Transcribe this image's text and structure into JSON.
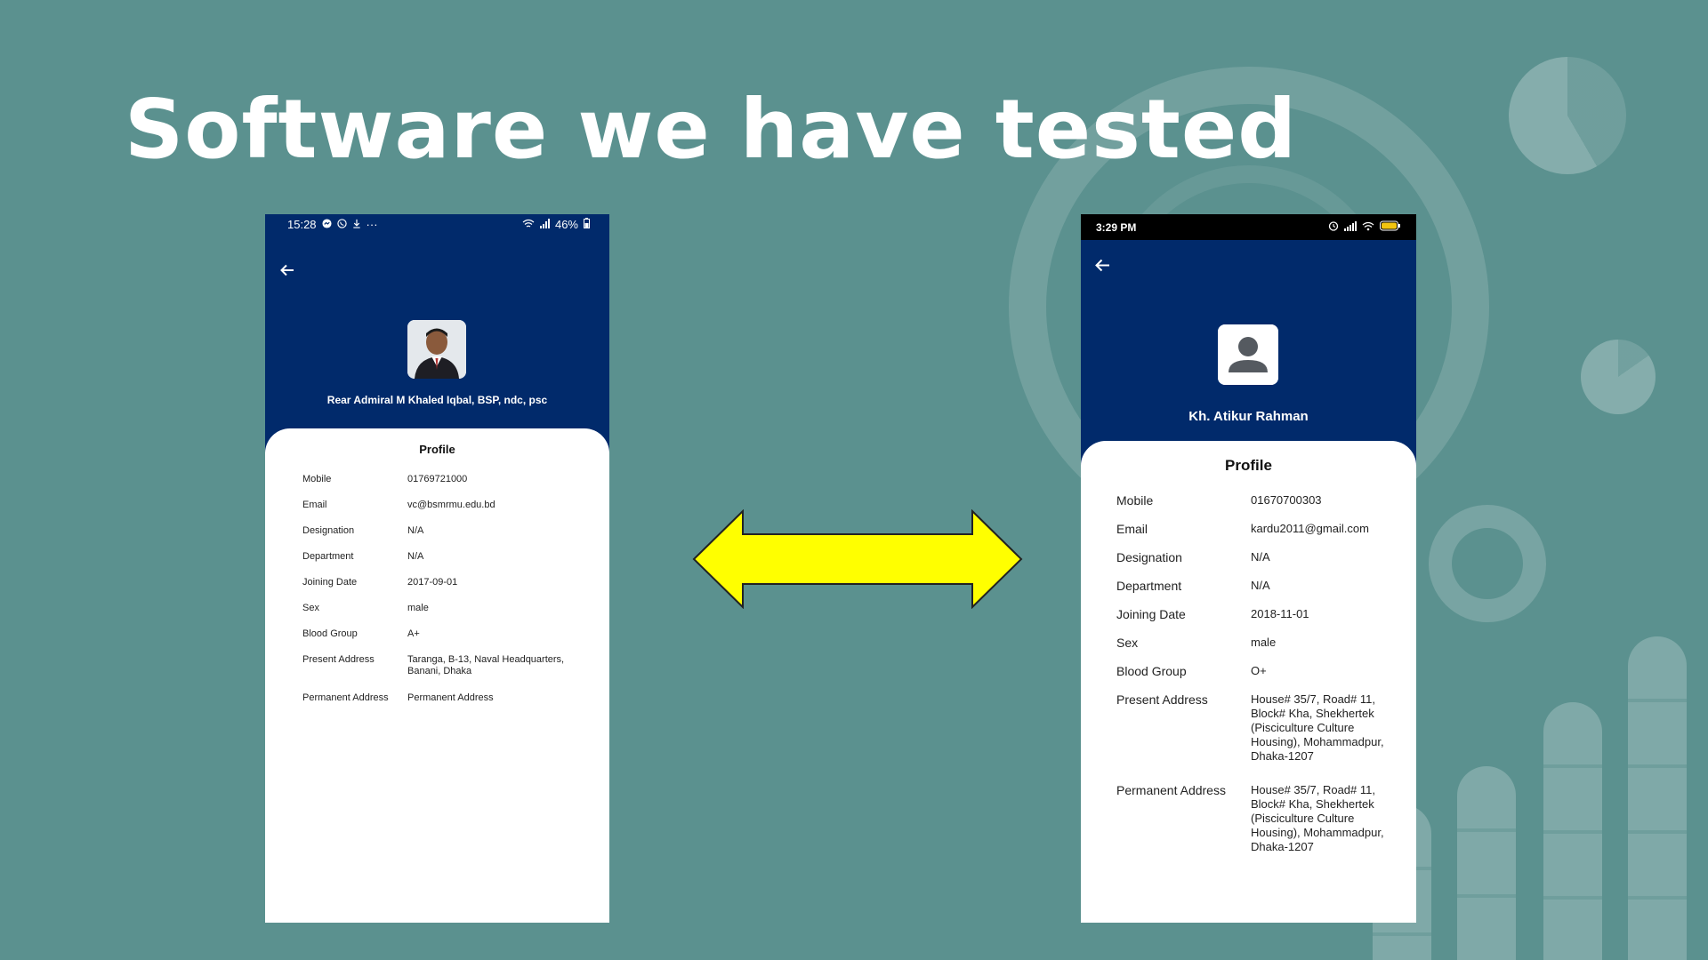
{
  "slide": {
    "title": "Software we have tested"
  },
  "colors": {
    "background": "#5b918f",
    "header_blue": "#012a6b",
    "arrow_fill": "#ffff00",
    "arrow_stroke": "#222222"
  },
  "left_phone": {
    "status_bar": {
      "time": "15:28",
      "icons_left": [
        "messenger-icon",
        "viber-icon",
        "download-icon",
        "more-dots-icon"
      ],
      "dots": "···",
      "battery": "46%"
    },
    "name": "Rear Admiral M Khaled Iqbal, BSP, ndc, psc",
    "card_title": "Profile",
    "fields": [
      {
        "label": "Mobile",
        "value": "01769721000"
      },
      {
        "label": "Email",
        "value": "vc@bsmrmu.edu.bd"
      },
      {
        "label": "Designation",
        "value": "N/A"
      },
      {
        "label": "Department",
        "value": "N/A"
      },
      {
        "label": "Joining Date",
        "value": "2017-09-01"
      },
      {
        "label": "Sex",
        "value": "male"
      },
      {
        "label": "Blood Group",
        "value": "A+"
      },
      {
        "label": "Present Address",
        "value": "Taranga, B-13, Naval Headquarters, Banani, Dhaka"
      },
      {
        "label": "Permanent Address",
        "value": "Permanent Address"
      }
    ]
  },
  "right_phone": {
    "status_bar": {
      "time": "3:29 PM",
      "icons_right": [
        "alarm-icon",
        "signal-icon",
        "wifi-icon",
        "battery-icon"
      ]
    },
    "name": "Kh. Atikur Rahman",
    "card_title": "Profile",
    "fields": [
      {
        "label": "Mobile",
        "value": "01670700303"
      },
      {
        "label": "Email",
        "value": "kardu2011@gmail.com"
      },
      {
        "label": "Designation",
        "value": "N/A"
      },
      {
        "label": "Department",
        "value": "N/A"
      },
      {
        "label": "Joining Date",
        "value": "2018-11-01"
      },
      {
        "label": "Sex",
        "value": "male"
      },
      {
        "label": "Blood Group",
        "value": "O+"
      },
      {
        "label": "Present Address",
        "value": "House# 35/7, Road# 11, Block# Kha, Shekhertek (Pisciculture Culture Housing), Mohammadpur, Dhaka-1207"
      },
      {
        "label": "Permanent Address",
        "value": "House# 35/7, Road# 11, Block# Kha, Shekhertek (Pisciculture Culture Housing), Mohammadpur, Dhaka-1207"
      }
    ]
  }
}
